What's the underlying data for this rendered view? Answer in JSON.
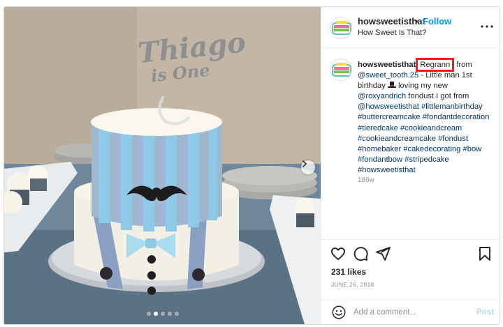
{
  "post": {
    "image_alt": "Two-tier blue striped cake with mustache, bow tie and suspenders, topper reading Thiago is One",
    "topper_line1": "Thiago",
    "topper_line2": "is One",
    "carousel": {
      "dots": 5,
      "active_dot": 1
    }
  },
  "header": {
    "username": "howsweetisthat",
    "separator": "•",
    "follow_label": "Follow",
    "subtitle": "How Sweet Is That?",
    "more_icon": "more-horizontal-icon"
  },
  "caption": {
    "username": "howsweetisthat",
    "highlight": "Regrann",
    "text_after_highlight": " from",
    "mention_1": "@sweet_tooth.25",
    "text_1": " - Little man 1st birthday ",
    "emoji": "top-hat",
    "text_2": " loving my new ",
    "mention_2": "@roxyandrich",
    "text_3": " fondust I got from ",
    "mention_3": "@howsweetisthat",
    "hashtags": "#littlemanbirthday #buttercreamcake #fondantdecoration #tieredcake #cookieandcream #cookieandcreamcake #fondust #homebaker #cakedecorating #bow #fondantbow #stripedcake #howsweetisthat",
    "time": "186w"
  },
  "actions": {
    "like_icon": "heart-icon",
    "comment_icon": "comment-icon",
    "share_icon": "send-icon",
    "save_icon": "bookmark-icon"
  },
  "likes": "231 likes",
  "date": "JUNE 26, 2018",
  "add_comment": {
    "placeholder": "Add a comment...",
    "post_label": "Post"
  },
  "colors": {
    "accent": "#0095f6",
    "highlight_box": "#ff1a1a",
    "link": "#00376b",
    "muted": "#8e8e8e"
  }
}
